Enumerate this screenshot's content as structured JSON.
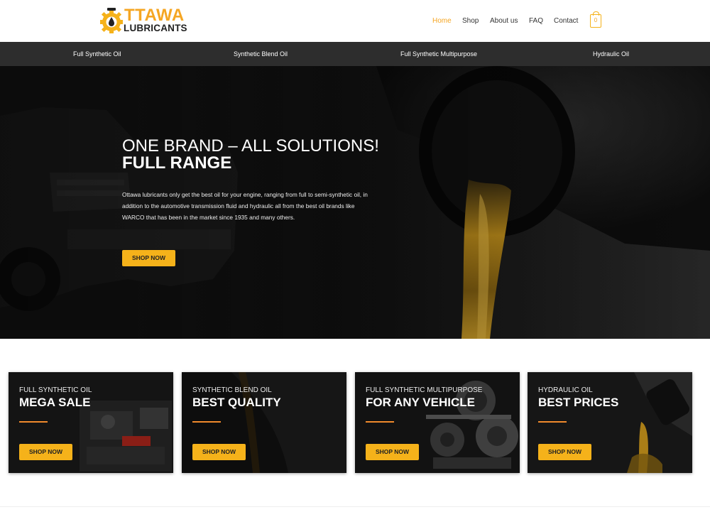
{
  "logo": {
    "line1": "TTAWA",
    "line2": "LUBRICANTS",
    "alt_brand": "OTTAWA LUBRICANTS"
  },
  "nav": {
    "items": [
      {
        "label": "Home",
        "active": true
      },
      {
        "label": "Shop",
        "active": false
      },
      {
        "label": "About us",
        "active": false
      },
      {
        "label": "FAQ",
        "active": false
      },
      {
        "label": "Contact",
        "active": false
      }
    ],
    "cart_count": "0"
  },
  "categories": [
    {
      "label": "Full Synthetic Oil"
    },
    {
      "label": "Synthetic Blend Oil"
    },
    {
      "label": "Full Synthetic Multipurpose"
    },
    {
      "label": "Hydraulic Oil"
    }
  ],
  "hero": {
    "title_line1": "ONE BRAND – ALL SOLUTIONS!",
    "title_line2": "FULL RANGE",
    "description": "Ottawa lubricants only get the best oil for your engine, ranging from full to semi-synthetic oil, in addition to the automotive transmission fluid and hydraulic all from the best oil brands like WARCO that has been in the market since 1935 and many others.",
    "button_label": "SHOP NOW"
  },
  "cards": [
    {
      "subtitle": "FULL SYNTHETIC OIL",
      "title": "MEGA SALE",
      "button_label": "SHOP NOW"
    },
    {
      "subtitle": "SYNTHETIC BLEND OIL",
      "title": "BEST QUALITY",
      "button_label": "SHOP NOW"
    },
    {
      "subtitle": "FULL SYNTHETIC MULTIPURPOSE",
      "title": "FOR ANY VEHICLE",
      "button_label": "SHOP NOW"
    },
    {
      "subtitle": "HYDRAULIC OIL",
      "title": "BEST PRICES",
      "button_label": "SHOP NOW"
    }
  ],
  "colors": {
    "accent": "#f5b21a",
    "active_nav": "#f5a623",
    "category_bar": "#2d2d2d",
    "divider": "#f08a2c"
  }
}
